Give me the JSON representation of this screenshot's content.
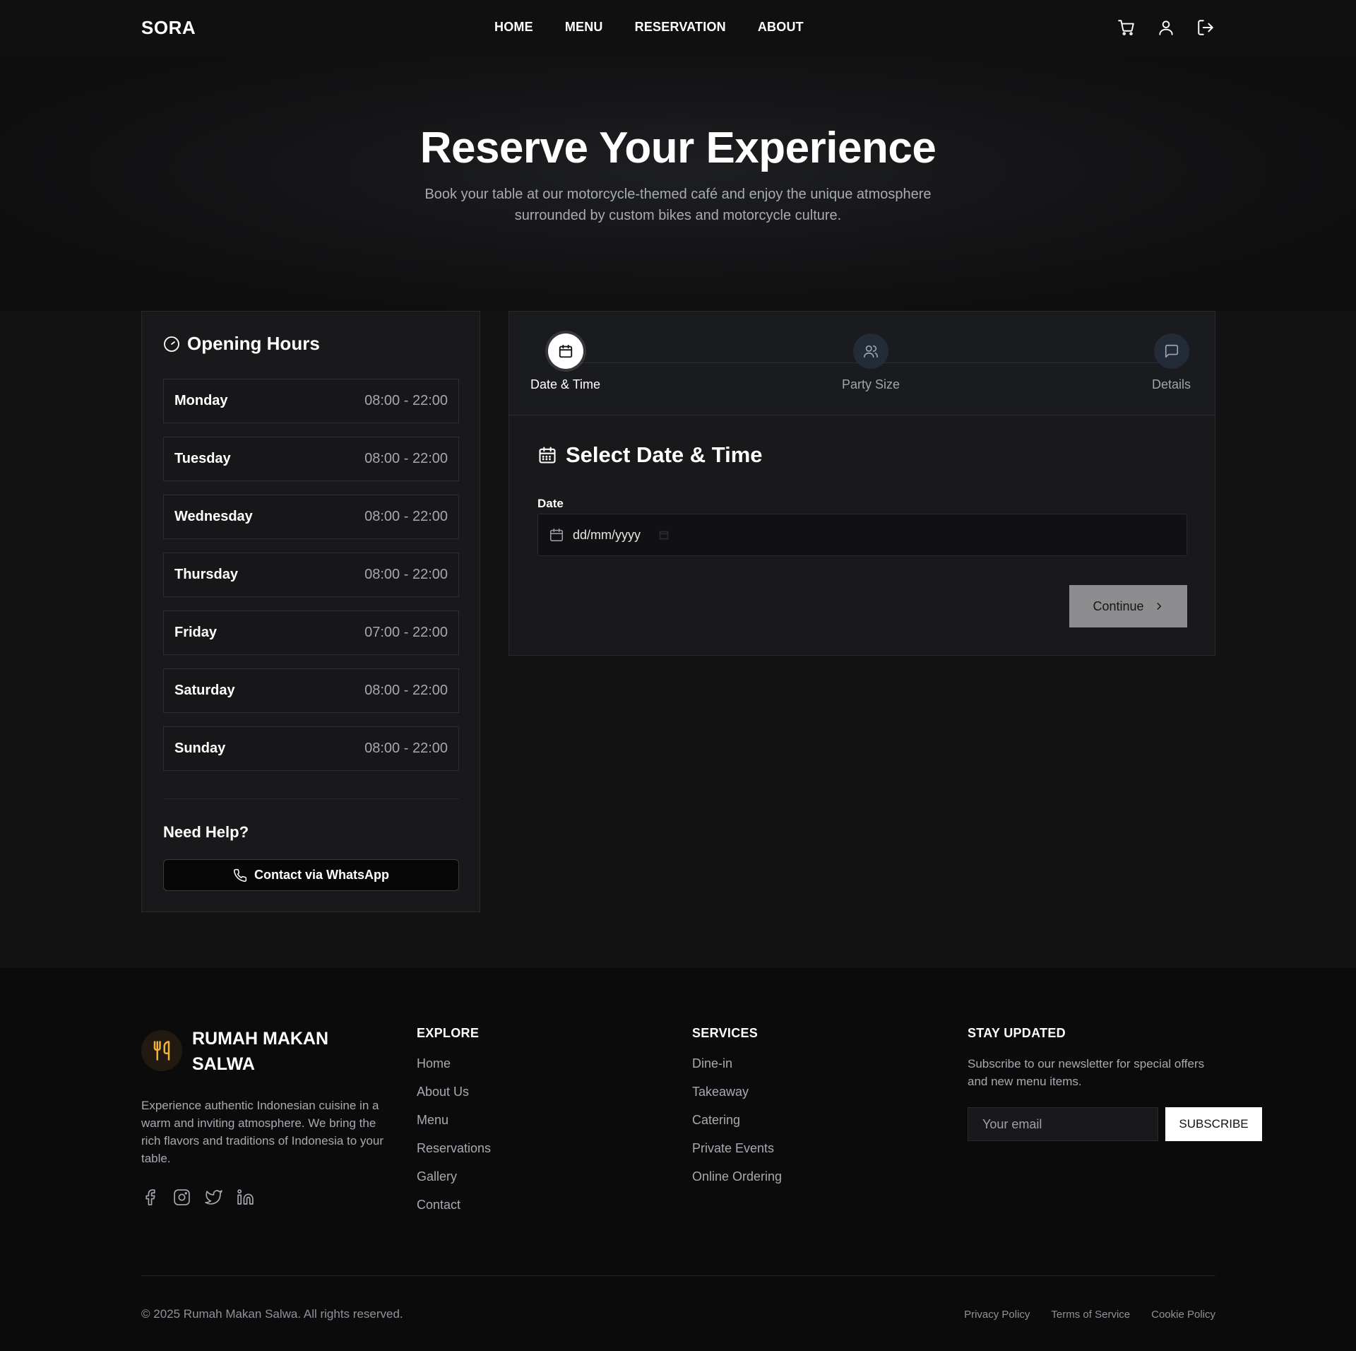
{
  "header": {
    "logo": "SORA",
    "nav": [
      "HOME",
      "MENU",
      "RESERVATION",
      "ABOUT"
    ],
    "icons": [
      "cart-icon",
      "user-icon",
      "logout-icon"
    ]
  },
  "hero": {
    "title": "Reserve Your Experience",
    "subtitle": "Book your table at our motorcycle-themed café and enjoy the unique atmosphere surrounded by custom bikes and motorcycle culture."
  },
  "hours": {
    "title": "Opening Hours",
    "days": [
      {
        "day": "Monday",
        "time": "08:00 - 22:00"
      },
      {
        "day": "Tuesday",
        "time": "08:00 - 22:00"
      },
      {
        "day": "Wednesday",
        "time": "08:00 - 22:00"
      },
      {
        "day": "Thursday",
        "time": "08:00 - 22:00"
      },
      {
        "day": "Friday",
        "time": "07:00 - 22:00"
      },
      {
        "day": "Saturday",
        "time": "08:00 - 22:00"
      },
      {
        "day": "Sunday",
        "time": "08:00 - 22:00"
      }
    ],
    "help_title": "Need Help?",
    "whatsapp_label": "Contact via WhatsApp"
  },
  "reservation": {
    "steps": [
      "Date & Time",
      "Party Size",
      "Details"
    ],
    "active_step": 0,
    "section_title": "Select Date & Time",
    "date_label": "Date",
    "date_placeholder": "dd/mm/yyyy",
    "continue_label": "Continue"
  },
  "footer": {
    "brand_name": "RUMAH MAKAN SALWA",
    "brand_desc": "Experience authentic Indonesian cuisine in a warm and inviting atmosphere. We bring the rich flavors and traditions of Indonesia to your table.",
    "socials": [
      "facebook-icon",
      "instagram-icon",
      "twitter-icon",
      "linkedin-icon"
    ],
    "explore": {
      "title": "EXPLORE",
      "links": [
        "Home",
        "About Us",
        "Menu",
        "Reservations",
        "Gallery",
        "Contact"
      ]
    },
    "services": {
      "title": "SERVICES",
      "links": [
        "Dine-in",
        "Takeaway",
        "Catering",
        "Private Events",
        "Online Ordering"
      ]
    },
    "newsletter": {
      "title": "STAY UPDATED",
      "text": "Subscribe to our newsletter for special offers and new menu items.",
      "email_placeholder": "Your email",
      "subscribe_label": "SUBSCRIBE"
    },
    "copyright": "© 2025 Rumah Makan Salwa. All rights reserved.",
    "legal": [
      "Privacy Policy",
      "Terms of Service",
      "Cookie Policy"
    ]
  },
  "colors": {
    "background": "#0f0f10",
    "card": "#19191b",
    "muted_text": "#a7aab0",
    "brand_accent": "#f2b233",
    "continue_button": "#8d8d8f"
  }
}
